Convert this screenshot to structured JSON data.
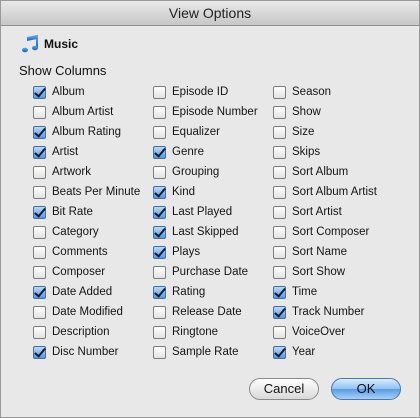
{
  "window": {
    "title": "View Options"
  },
  "source": {
    "label": "Music",
    "icon": "music-note-icon"
  },
  "section": {
    "title": "Show Columns"
  },
  "columns": [
    [
      {
        "label": "Album",
        "checked": true
      },
      {
        "label": "Album Artist",
        "checked": false
      },
      {
        "label": "Album Rating",
        "checked": true
      },
      {
        "label": "Artist",
        "checked": true
      },
      {
        "label": "Artwork",
        "checked": false
      },
      {
        "label": "Beats Per Minute",
        "checked": false
      },
      {
        "label": "Bit Rate",
        "checked": true
      },
      {
        "label": "Category",
        "checked": false
      },
      {
        "label": "Comments",
        "checked": false
      },
      {
        "label": "Composer",
        "checked": false
      },
      {
        "label": "Date Added",
        "checked": true
      },
      {
        "label": "Date Modified",
        "checked": false
      },
      {
        "label": "Description",
        "checked": false
      },
      {
        "label": "Disc Number",
        "checked": true
      }
    ],
    [
      {
        "label": "Episode ID",
        "checked": false
      },
      {
        "label": "Episode Number",
        "checked": false
      },
      {
        "label": "Equalizer",
        "checked": false
      },
      {
        "label": "Genre",
        "checked": true
      },
      {
        "label": "Grouping",
        "checked": false
      },
      {
        "label": "Kind",
        "checked": true
      },
      {
        "label": "Last Played",
        "checked": true
      },
      {
        "label": "Last Skipped",
        "checked": true
      },
      {
        "label": "Plays",
        "checked": true
      },
      {
        "label": "Purchase Date",
        "checked": false
      },
      {
        "label": "Rating",
        "checked": true
      },
      {
        "label": "Release Date",
        "checked": false
      },
      {
        "label": "Ringtone",
        "checked": false
      },
      {
        "label": "Sample Rate",
        "checked": false
      }
    ],
    [
      {
        "label": "Season",
        "checked": false
      },
      {
        "label": "Show",
        "checked": false
      },
      {
        "label": "Size",
        "checked": false
      },
      {
        "label": "Skips",
        "checked": false
      },
      {
        "label": "Sort Album",
        "checked": false
      },
      {
        "label": "Sort Album Artist",
        "checked": false
      },
      {
        "label": "Sort Artist",
        "checked": false
      },
      {
        "label": "Sort Composer",
        "checked": false
      },
      {
        "label": "Sort Name",
        "checked": false
      },
      {
        "label": "Sort Show",
        "checked": false
      },
      {
        "label": "Time",
        "checked": true
      },
      {
        "label": "Track Number",
        "checked": true
      },
      {
        "label": "VoiceOver",
        "checked": false
      },
      {
        "label": "Year",
        "checked": true
      }
    ]
  ],
  "buttons": {
    "cancel": "Cancel",
    "ok": "OK"
  }
}
